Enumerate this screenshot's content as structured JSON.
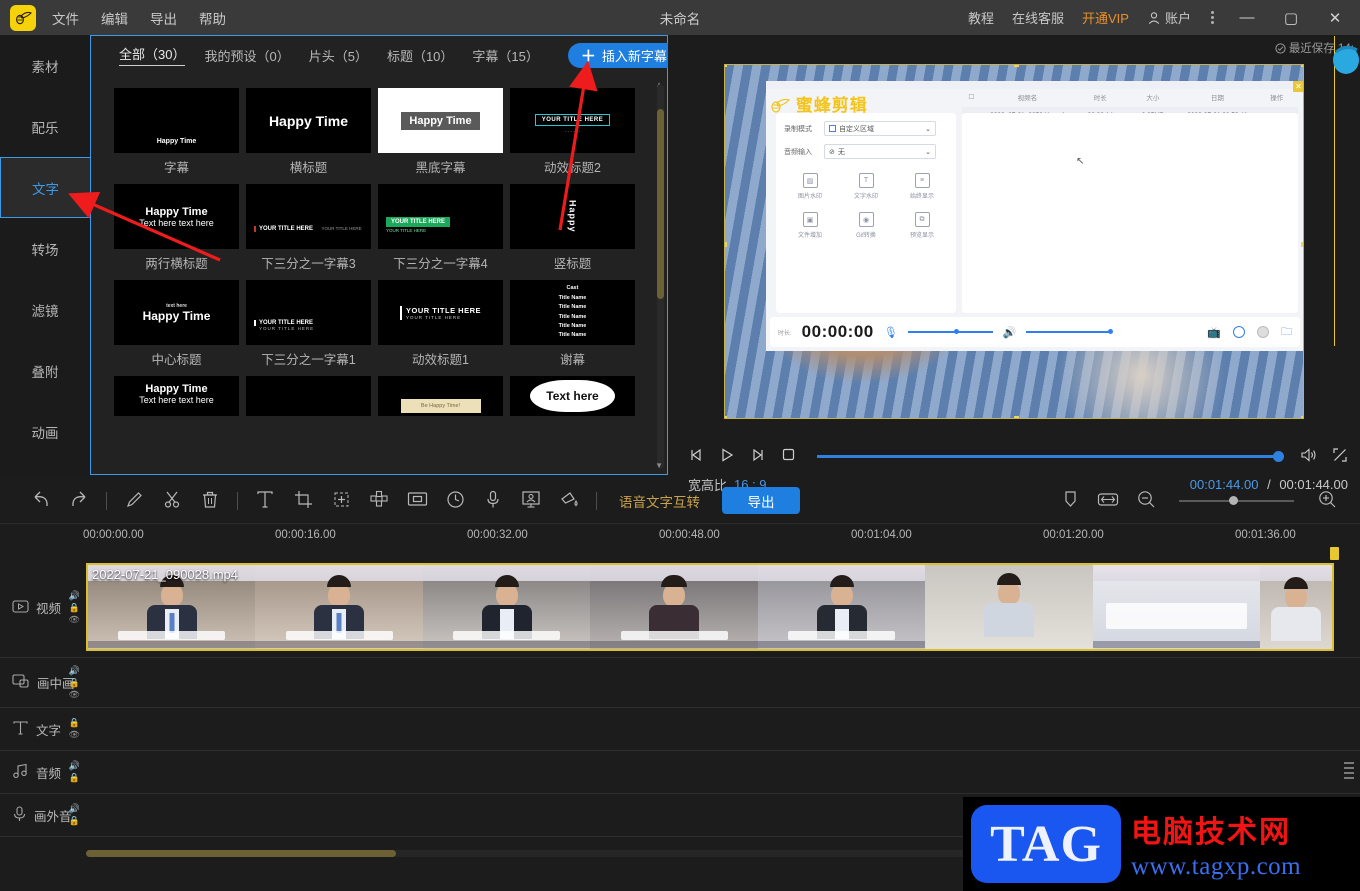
{
  "titlebar": {
    "logo": "bee-logo",
    "menus": [
      "文件",
      "编辑",
      "导出",
      "帮助"
    ],
    "window_title": "未命名",
    "right_items": [
      "教程",
      "在线客服"
    ],
    "vip_label": "开通VIP",
    "account_label": "账户",
    "minimize": "—",
    "maximize": "▢",
    "close": "✕"
  },
  "sidebar": {
    "items": [
      {
        "label": "素材",
        "active": false
      },
      {
        "label": "配乐",
        "active": false
      },
      {
        "label": "文字",
        "active": true
      },
      {
        "label": "转场",
        "active": false
      },
      {
        "label": "滤镜",
        "active": false
      },
      {
        "label": "叠附",
        "active": false
      },
      {
        "label": "动画",
        "active": false
      }
    ]
  },
  "panel": {
    "tabs": [
      {
        "label": "全部（30）",
        "active": true
      },
      {
        "label": "我的预设（0）",
        "active": false
      },
      {
        "label": "片头（5）",
        "active": false
      },
      {
        "label": "标题（10）",
        "active": false
      },
      {
        "label": "字幕（15）",
        "active": false
      }
    ],
    "insert_button": "插入新字幕",
    "insert_plus": "＋",
    "templates": [
      {
        "caption": "字幕",
        "preview_text": "Happy Time"
      },
      {
        "caption": "横标题",
        "preview_text": "Happy Time"
      },
      {
        "caption": "黑底字幕",
        "preview_text": "Happy Time"
      },
      {
        "caption": "动效标题2",
        "preview_text": "YOUR TITLE HERE"
      },
      {
        "caption": "两行横标题",
        "preview_text": "Happy Time",
        "preview_sub": "Text here text here"
      },
      {
        "caption": "下三分之一字幕3",
        "preview_text": "YOUR TITLE HERE",
        "preview_sub": "YOUR TITLE HERE"
      },
      {
        "caption": "下三分之一字幕4",
        "preview_text": "YOUR TITLE HERE",
        "preview_sub": "YOUR TITLE HERE"
      },
      {
        "caption": "竖标题",
        "preview_text": "Happy"
      },
      {
        "caption": "中心标题",
        "preview_text": "Happy Time",
        "preview_sub": "text here"
      },
      {
        "caption": "下三分之一字幕1",
        "preview_text": "YOUR TITLE HERE",
        "preview_sub": "YOUR TITLE HERE"
      },
      {
        "caption": "动效标题1",
        "preview_text": "YOUR TITLE HERE",
        "preview_sub": "YOUR TITLE HERE"
      },
      {
        "caption": "谢幕",
        "preview_text": "Cast",
        "preview_sub": "Title Name"
      },
      {
        "caption": "",
        "preview_text": "Happy Time",
        "preview_sub": "Text here text here"
      },
      {
        "caption": "",
        "preview_text": ""
      },
      {
        "caption": "",
        "preview_text": "Be Happy Time!"
      },
      {
        "caption": "",
        "preview_text": "Text here"
      }
    ]
  },
  "preview": {
    "save_status": "最近保存 14:",
    "nested": {
      "brand": "蜜蜂剪辑",
      "record_mode_label": "录制模式",
      "record_mode_value": "自定义区域",
      "audio_input_label": "音频输入",
      "audio_input_value": "无",
      "tools": [
        "图片水印",
        "文字水印",
        "始终显示",
        "文件增加",
        "Gif转换",
        "预览显示"
      ],
      "table_headers": [
        "",
        "视频名",
        "时长",
        "大小",
        "日期",
        "操作"
      ],
      "table_row": [
        "2022_07-21_085941.mp4",
        "00:00:14",
        "2.05MB",
        "2022-07-21 08:59:41"
      ],
      "time_label": "时长:",
      "time_value": "00:00:00",
      "close": "✕"
    },
    "controls": {
      "prev_frame": "◁|",
      "play": "▷",
      "next_frame": "|▷",
      "stop": "▢",
      "volume": "volume-icon",
      "fullscreen": "fullscreen-icon"
    },
    "ratio_label": "宽高比",
    "ratio_value": "16 : 9",
    "current_time": "00:01:44.00",
    "total_time": "00:01:44.00",
    "time_sep": "/"
  },
  "toolbar": {
    "icons": [
      {
        "name": "undo-icon",
        "glyph": "↰"
      },
      {
        "name": "redo-icon",
        "glyph": "↱"
      },
      {
        "name": "edit-pencil-icon",
        "glyph": "✎"
      },
      {
        "name": "cut-scissors-icon",
        "glyph": "✂"
      },
      {
        "name": "delete-trash-icon",
        "glyph": "🗑"
      },
      {
        "name": "text-icon",
        "glyph": "T"
      },
      {
        "name": "crop-icon",
        "glyph": "⌗"
      },
      {
        "name": "add-frame-icon",
        "glyph": "⊞"
      },
      {
        "name": "mosaic-icon",
        "glyph": "❖"
      },
      {
        "name": "pip-icon",
        "glyph": "▣"
      },
      {
        "name": "speed-clock-icon",
        "glyph": "◷"
      },
      {
        "name": "microphone-icon",
        "glyph": "🎙"
      },
      {
        "name": "green-screen-icon",
        "glyph": "⊡"
      },
      {
        "name": "paint-bucket-icon",
        "glyph": "◣"
      }
    ],
    "voice_text_label": "语音文字互转",
    "export_label": "导出",
    "right_icons": [
      {
        "name": "marker-icon",
        "glyph": "⬯"
      },
      {
        "name": "fit-width-icon",
        "glyph": "↔"
      },
      {
        "name": "zoom-out-icon",
        "glyph": "⊖"
      },
      {
        "name": "zoom-in-icon",
        "glyph": "⊕"
      }
    ]
  },
  "timeline": {
    "ruler_labels": [
      "00:00:00.00",
      "00:00:16.00",
      "00:00:32.00",
      "00:00:48.00",
      "00:01:04.00",
      "00:01:20.00",
      "00:01:36.00"
    ],
    "clip_name": "2022-07-21_090028.mp4",
    "tracks": [
      {
        "label": "视频",
        "icon": "video-icon",
        "controls": [
          "speaker",
          "lock",
          "eye"
        ]
      },
      {
        "label": "画中画",
        "icon": "pip-icon",
        "controls": [
          "speaker",
          "lock",
          "eye"
        ]
      },
      {
        "label": "文字",
        "icon": "text-icon",
        "controls": [
          "lock",
          "eye"
        ]
      },
      {
        "label": "音频",
        "icon": "audio-icon",
        "controls": [
          "speaker",
          "lock"
        ]
      },
      {
        "label": "画外音",
        "icon": "mic-icon",
        "controls": [
          "speaker",
          "lock"
        ]
      }
    ]
  },
  "watermark": {
    "tag": "TAG",
    "site_cn": "电脑技术网",
    "site_url": "www.tagxp.com"
  }
}
